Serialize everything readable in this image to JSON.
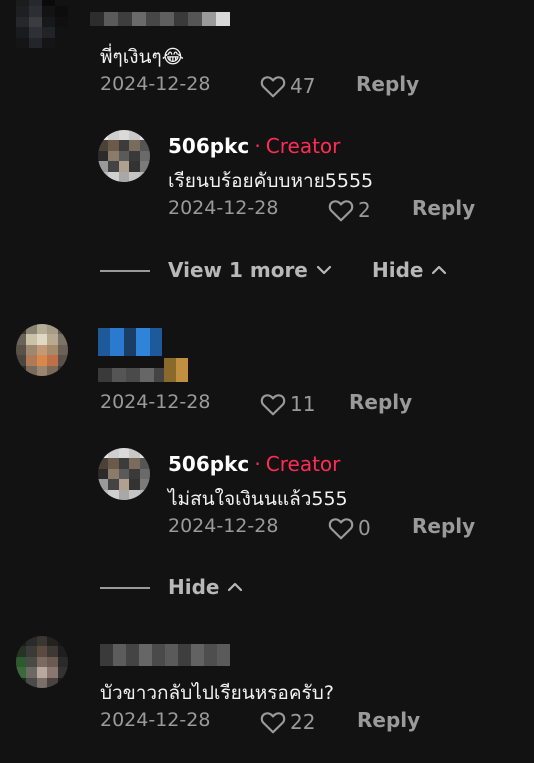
{
  "comments": [
    {
      "text": "พี่ๆเงินๆ😂",
      "date": "2024-12-28",
      "likes": "47",
      "reply_label": "Reply",
      "reply": {
        "handle": "506pkc",
        "separator": "·",
        "badge": "Creator",
        "text": "เรียนบร้อยคับบหาย5555",
        "date": "2024-12-28",
        "likes": "2",
        "reply_label": "Reply"
      },
      "thread": {
        "view_more": "View 1 more",
        "hide": "Hide"
      }
    },
    {
      "text": "",
      "date": "2024-12-28",
      "likes": "11",
      "reply_label": "Reply",
      "reply": {
        "handle": "506pkc",
        "separator": "·",
        "badge": "Creator",
        "text": "ไม่สนใจเงินนแล้ว555",
        "date": "2024-12-28",
        "likes": "0",
        "reply_label": "Reply"
      },
      "thread": {
        "hide": "Hide"
      }
    },
    {
      "text": "บัวขาวกลับไปเรียนหรอครับ?",
      "date": "2024-12-28",
      "likes": "22",
      "reply_label": "Reply"
    }
  ],
  "colors": {
    "accent": "#fe2c55",
    "muted": "#9a9a9a",
    "background": "#121212"
  }
}
